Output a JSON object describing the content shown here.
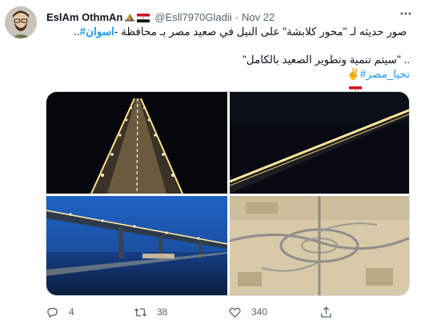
{
  "author": {
    "display_name": "EslAm OthmAn",
    "handle": "@Esll7970Gladii",
    "separator": "·",
    "date": "Nov 22"
  },
  "tweet": {
    "line1": {
      "text_a": "- صور حديثه لـ \"محور كلابشة\" على النيل في صعيد مصر بـ محافظة ",
      "hashtag": "#اسوان",
      "text_b": " .."
    },
    "line2": {
      "text": "\"سيتم تنمية وتطوير الصعيد بالكامل\" .."
    },
    "line3": {
      "hashtag": "#تحيا_مصر",
      "emoji": "✌️"
    }
  },
  "media": {
    "images": [
      {
        "label": "Night aerial of illuminated bridge, straight on"
      },
      {
        "label": "Night aerial of illuminated bridge, diagonal"
      },
      {
        "label": "Bridge lit at dusk over river with reflections"
      },
      {
        "label": "Desert highway interchange"
      }
    ]
  },
  "actions": {
    "reply_count": "4",
    "retweet_count": "38",
    "like_count": "340"
  },
  "colors": {
    "link": "#1d9bf0",
    "secondary_text": "#536471",
    "border": "#cfd9de"
  },
  "icons": [
    "pyramid-badge-icon",
    "egypt-flag-icon",
    "more-icon",
    "reply-icon",
    "retweet-icon",
    "like-icon",
    "share-icon"
  ]
}
